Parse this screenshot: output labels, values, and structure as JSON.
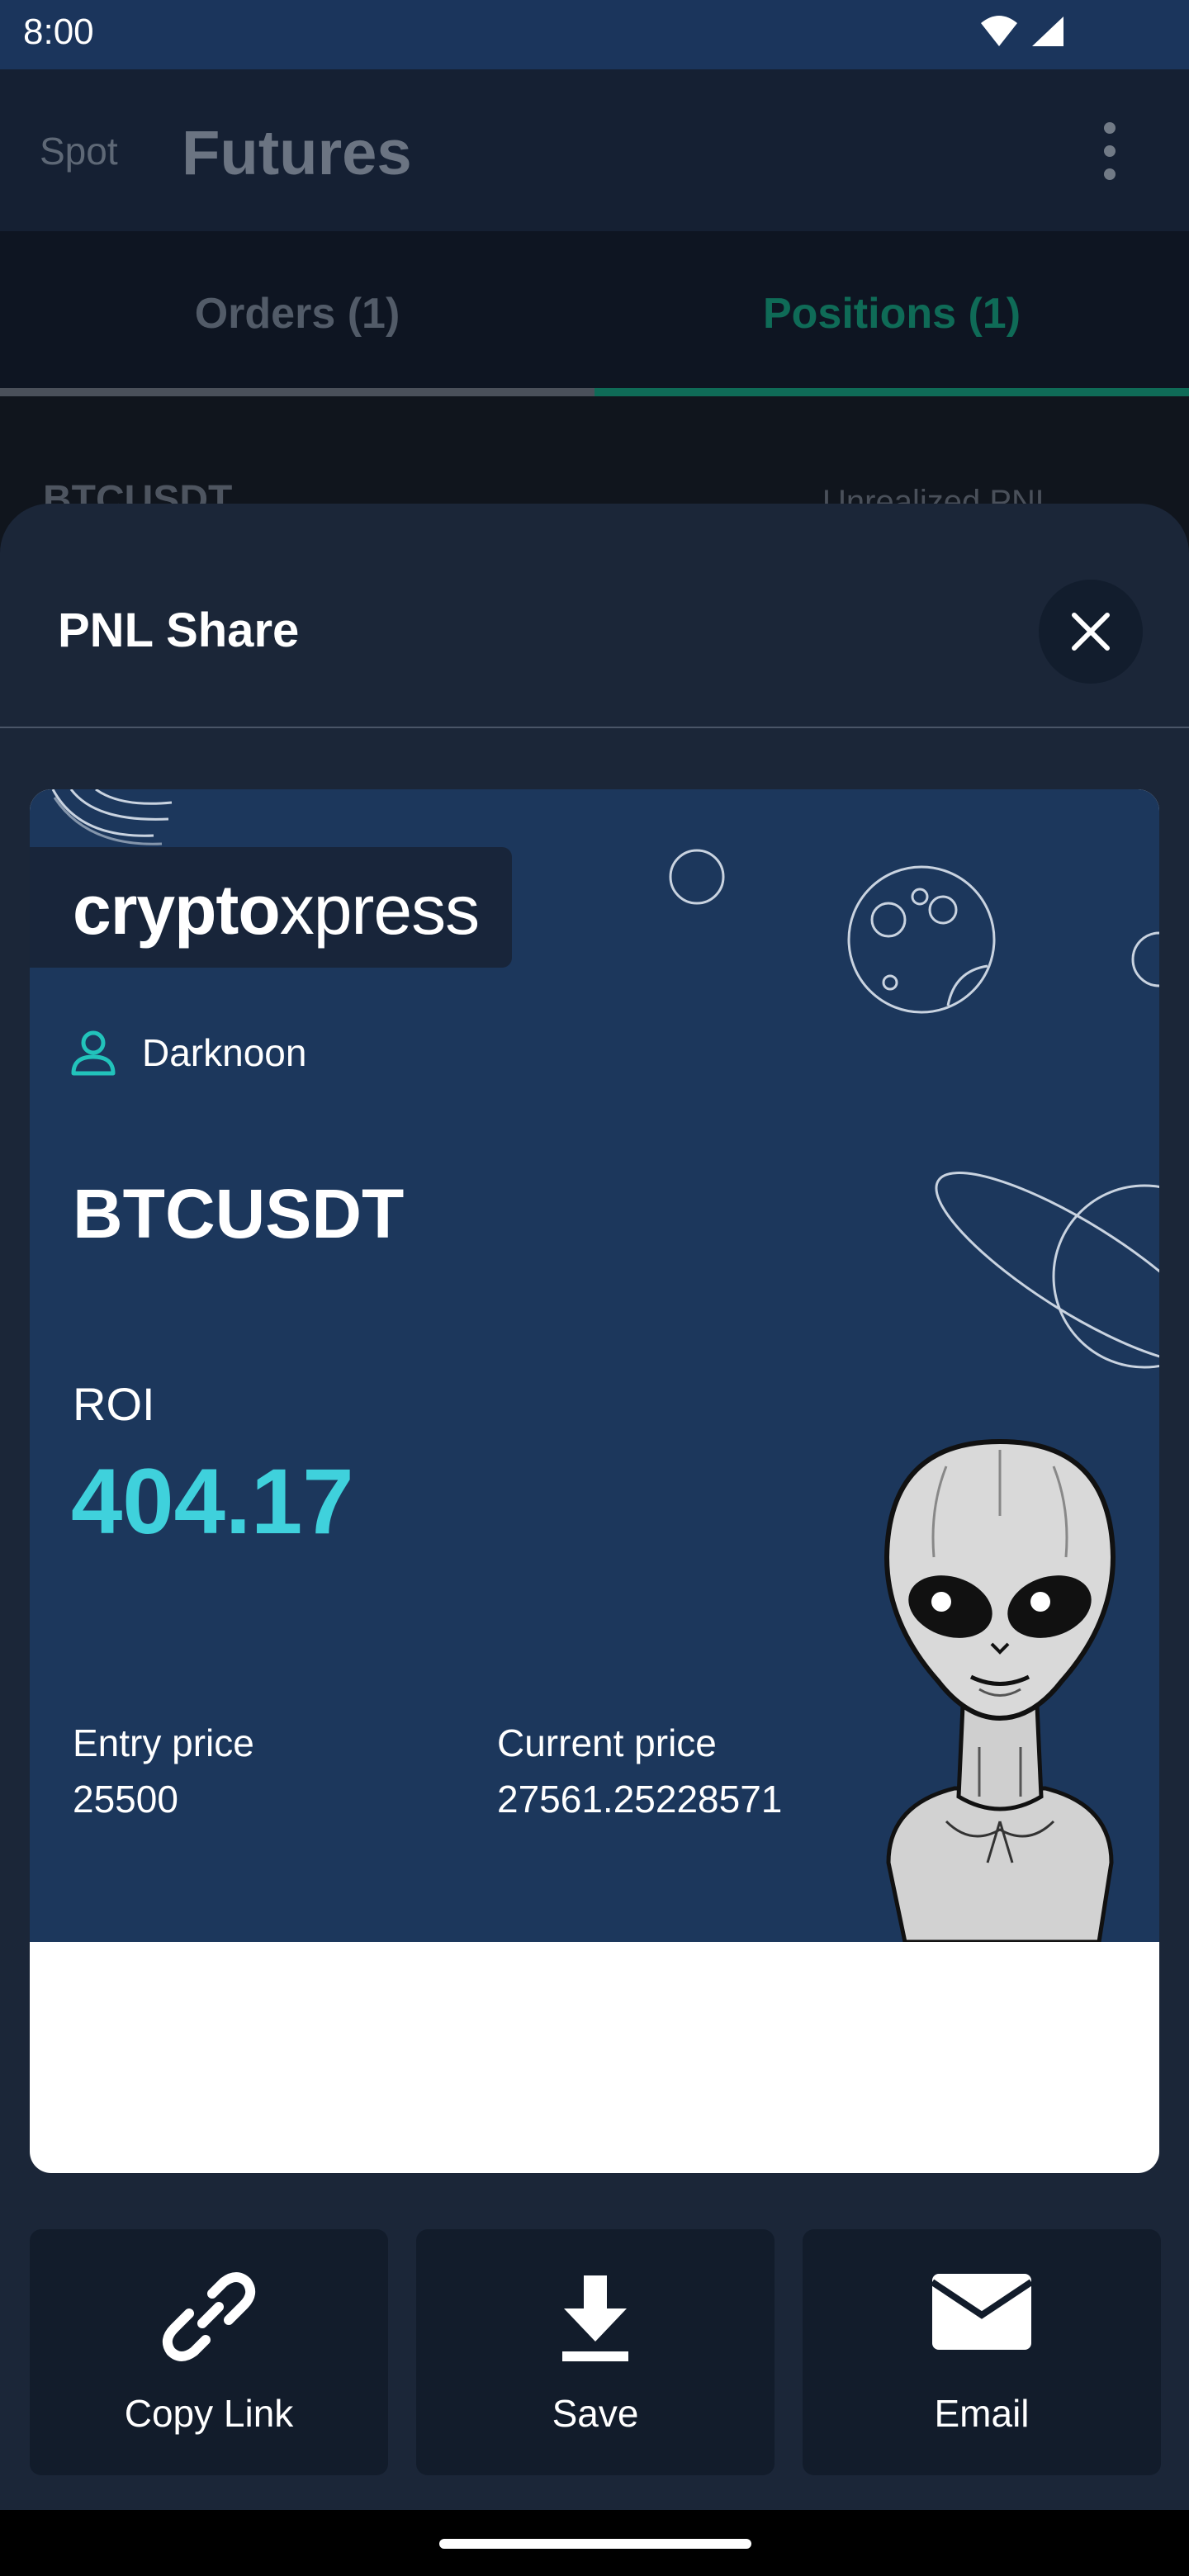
{
  "status_bar": {
    "time": "8:00"
  },
  "header": {
    "spot_label": "Spot",
    "futures_label": "Futures"
  },
  "order_tabs": {
    "orders_label": "Orders (1)",
    "positions_label": "Positions (1)"
  },
  "position_peek": {
    "symbol": "BTCUSDT",
    "unrealized_label": "Unrealized PNL"
  },
  "sheet": {
    "title": "PNL Share"
  },
  "card": {
    "brand_bold": "crypto",
    "brand_light": "xpress",
    "username": "Darknoon",
    "pair": "BTCUSDT",
    "roi_label": "ROI",
    "roi_value": "404.17",
    "entry_label": "Entry price",
    "entry_value": "25500",
    "current_label": "Current price",
    "current_value": "27561.25228571"
  },
  "actions": {
    "copy_link": "Copy Link",
    "save": "Save",
    "email": "Email"
  },
  "colors": {
    "accent_teal": "#3fd1dc",
    "positions_green": "#0f6b57",
    "card_bg": "#1c375c",
    "sheet_bg": "#1b2638"
  },
  "icons": {
    "close": "close-icon",
    "user": "user-icon",
    "copy_link": "link-icon",
    "save": "download-icon",
    "email": "mail-icon"
  }
}
